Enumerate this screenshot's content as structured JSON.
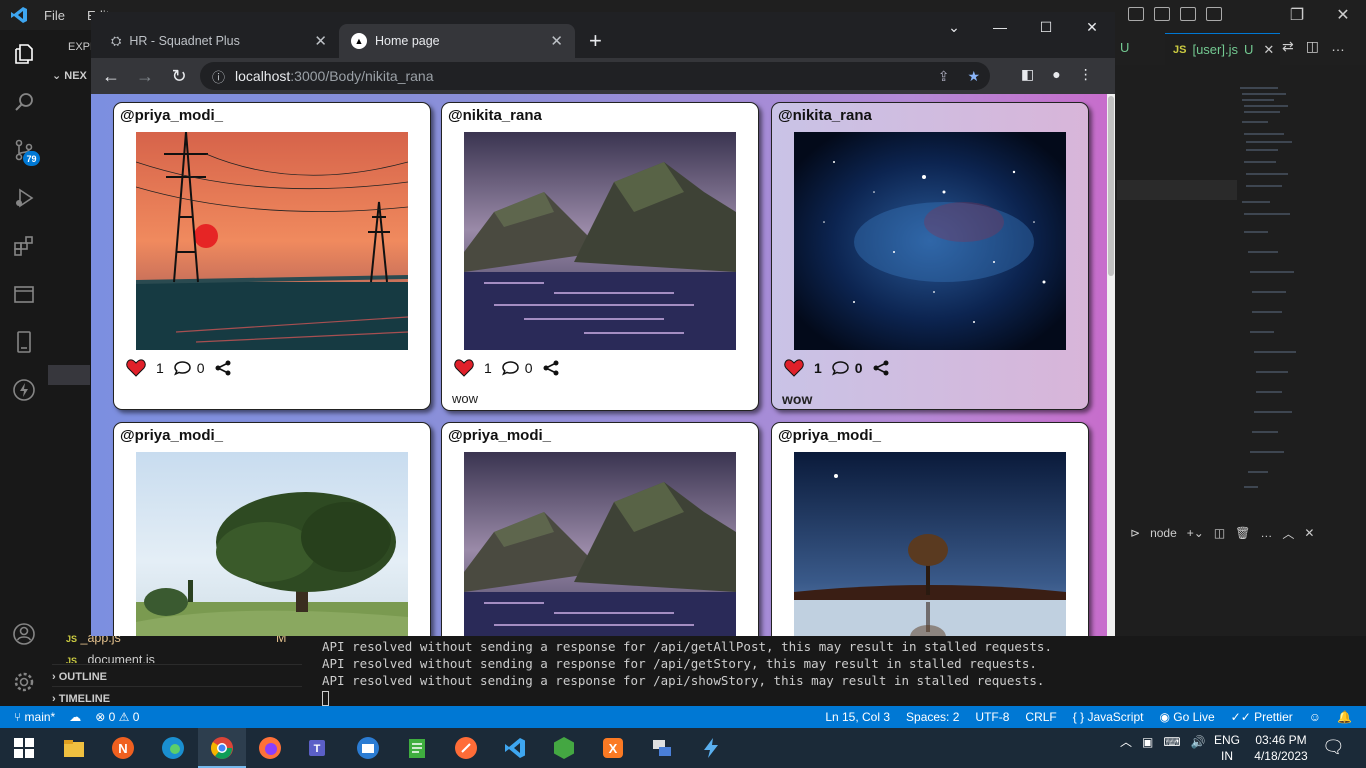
{
  "vscode": {
    "menu": [
      "File",
      "Edit"
    ],
    "explorer_label": "EXPL",
    "section_label": "NEX",
    "badge": "79",
    "files": [
      "_app.js",
      "_document.js"
    ],
    "file_badge": "M",
    "outline": "OUTLINE",
    "timeline": "TIMELINE",
    "tab_left_status": "U",
    "tab_user_icon": "JS",
    "tab_user_name": "[user].js",
    "tab_user_status": "U",
    "panel_terminal": "node",
    "terminal_lines": [
      "API resolved without sending a response for /api/getAllPost, this may result in stalled requests.",
      "API resolved without sending a response for /api/getStory, this may result in stalled requests.",
      "API resolved without sending a response for /api/showStory, this may result in stalled requests."
    ]
  },
  "statusbar": {
    "branch": "main*",
    "errors": "0",
    "warnings": "0",
    "position": "Ln 15, Col 3",
    "spaces": "Spaces: 2",
    "encoding": "UTF-8",
    "eol": "CRLF",
    "language": "JavaScript",
    "golive": "Go Live",
    "prettier": "Prettier"
  },
  "chrome": {
    "tabs": [
      {
        "title": "HR - Squadnet Plus",
        "active": false
      },
      {
        "title": "Home page",
        "active": true
      }
    ],
    "url_host": "localhost",
    "url_path": ":3000/Body/nikita_rana"
  },
  "posts": [
    {
      "user": "@priya_modi_",
      "image": "sunset-power-lines",
      "likes": "1",
      "comments": "0",
      "caption": ""
    },
    {
      "user": "@nikita_rana",
      "image": "purple-cliffs-coast",
      "likes": "1",
      "comments": "0",
      "caption": "wow"
    },
    {
      "user": "@nikita_rana",
      "image": "starry-galaxy",
      "likes": "1",
      "comments": "0",
      "caption": "wow"
    },
    {
      "user": "@priya_modi_",
      "image": "big-tree-meadow",
      "likes": "",
      "comments": "",
      "caption": ""
    },
    {
      "user": "@priya_modi_",
      "image": "purple-cliffs-coast",
      "likes": "",
      "comments": "",
      "caption": ""
    },
    {
      "user": "@priya_modi_",
      "image": "lone-tree-reflection",
      "likes": "",
      "comments": "",
      "caption": ""
    }
  ],
  "taskbar": {
    "lang_line1": "ENG",
    "lang_line2": "IN",
    "time": "03:46 PM",
    "date": "4/18/2023"
  }
}
